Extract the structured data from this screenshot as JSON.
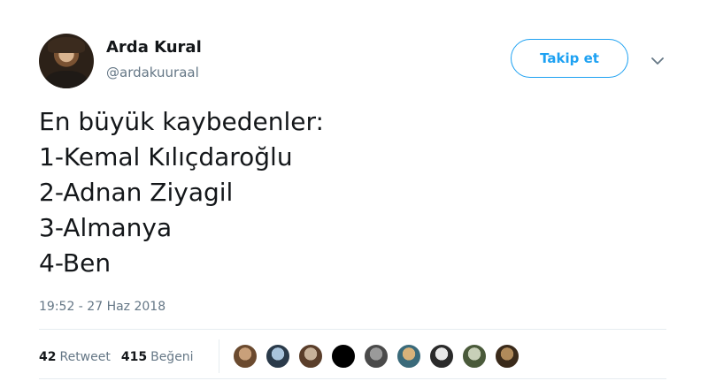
{
  "author": {
    "name": "Arda Kural",
    "handle": "@ardakuuraal"
  },
  "follow_button_label": "Takip et",
  "tweet": {
    "lines": [
      "En büyük kaybedenler:",
      "1-Kemal Kılıçdaroğlu",
      "2-Adnan Ziyagil",
      "3-Almanya",
      "4-Ben"
    ],
    "timestamp": "19:52 - 27 Haz 2018"
  },
  "stats": {
    "retweets": {
      "count": "42",
      "label": "Retweet"
    },
    "likes": {
      "count": "415",
      "label": "Beğeni"
    }
  },
  "colors": {
    "accent": "#1da1f2",
    "text": "#14171a",
    "muted": "#657786",
    "divider": "#e6ecf0"
  },
  "icons": {
    "more": "chevron-down-icon"
  },
  "likers": [
    {
      "color": "#c9a07a",
      "accent": "#6b4a2f"
    },
    {
      "color": "#a9c4dc",
      "accent": "#2a3a4a"
    },
    {
      "color": "#c7b29a",
      "accent": "#5a3e2a"
    },
    {
      "color": "#000000",
      "accent": "#000000"
    },
    {
      "color": "#9a9a9a",
      "accent": "#4a4a4a"
    },
    {
      "color": "#d8b27a",
      "accent": "#3a6a7a"
    },
    {
      "color": "#e8e8e8",
      "accent": "#2a2a2a"
    },
    {
      "color": "#c8d0b8",
      "accent": "#4a5a3a"
    },
    {
      "color": "#b08a5a",
      "accent": "#3a2a1a"
    }
  ]
}
